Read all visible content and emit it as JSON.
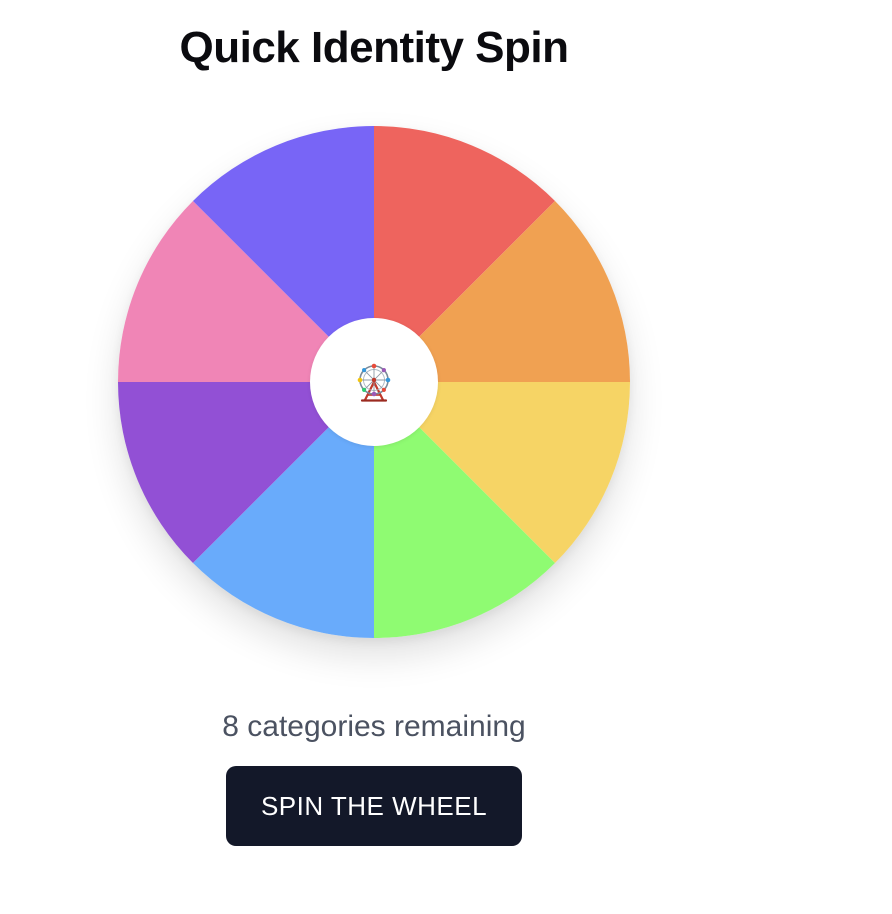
{
  "title": "Quick Identity Spin",
  "wheel": {
    "segment_count": 8,
    "segment_colors": [
      "#ee645e",
      "#f0a152",
      "#f6d465",
      "#8ffb72",
      "#69abfb",
      "#9250d5",
      "#f085b6",
      "#7865f6"
    ],
    "center_icon": "ferris-wheel-icon"
  },
  "status": {
    "text": "8 categories remaining"
  },
  "spin_button": {
    "label": "SPIN THE WHEEL"
  }
}
